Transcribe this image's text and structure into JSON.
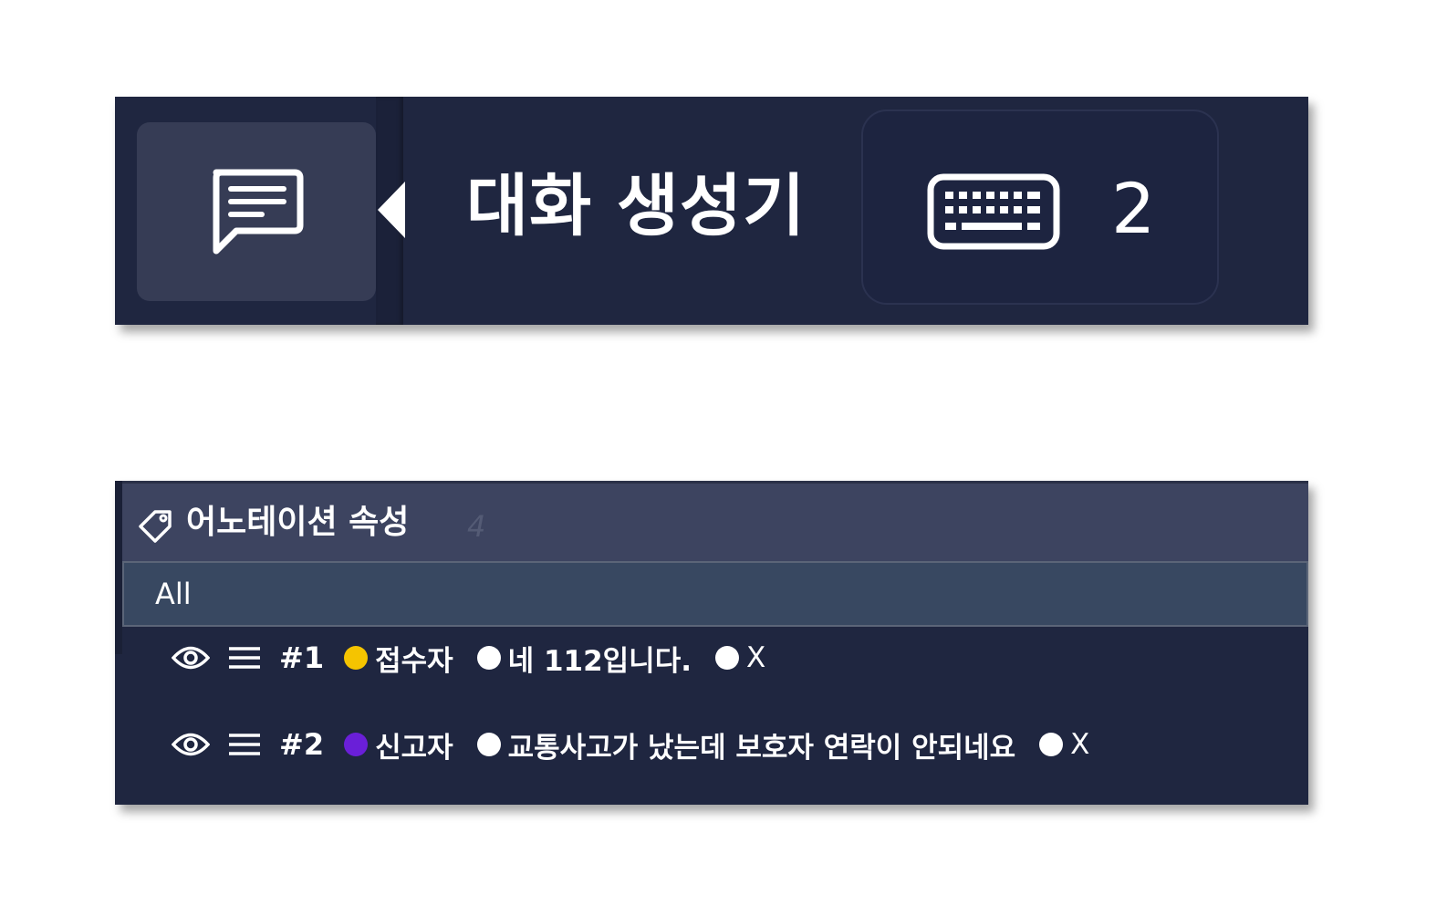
{
  "toolbar": {
    "tool_icon": "chat-message-icon",
    "title": "대화 생성기",
    "keyboard_icon": "keyboard-icon",
    "count": "2"
  },
  "annotation_panel": {
    "tag_icon": "tag-icon",
    "title": "어노테이션 속성",
    "count": "4",
    "filter": "All",
    "rows": [
      {
        "index": "#1",
        "role": "접수자",
        "role_color": "#f5c400",
        "utterance": "네 112입니다.",
        "flag": "X"
      },
      {
        "index": "#2",
        "role": "신고자",
        "role_color": "#6a1fd8",
        "utterance": "교통사고가 났는데 보호자 연락이 안되네요",
        "flag": "X"
      }
    ]
  }
}
